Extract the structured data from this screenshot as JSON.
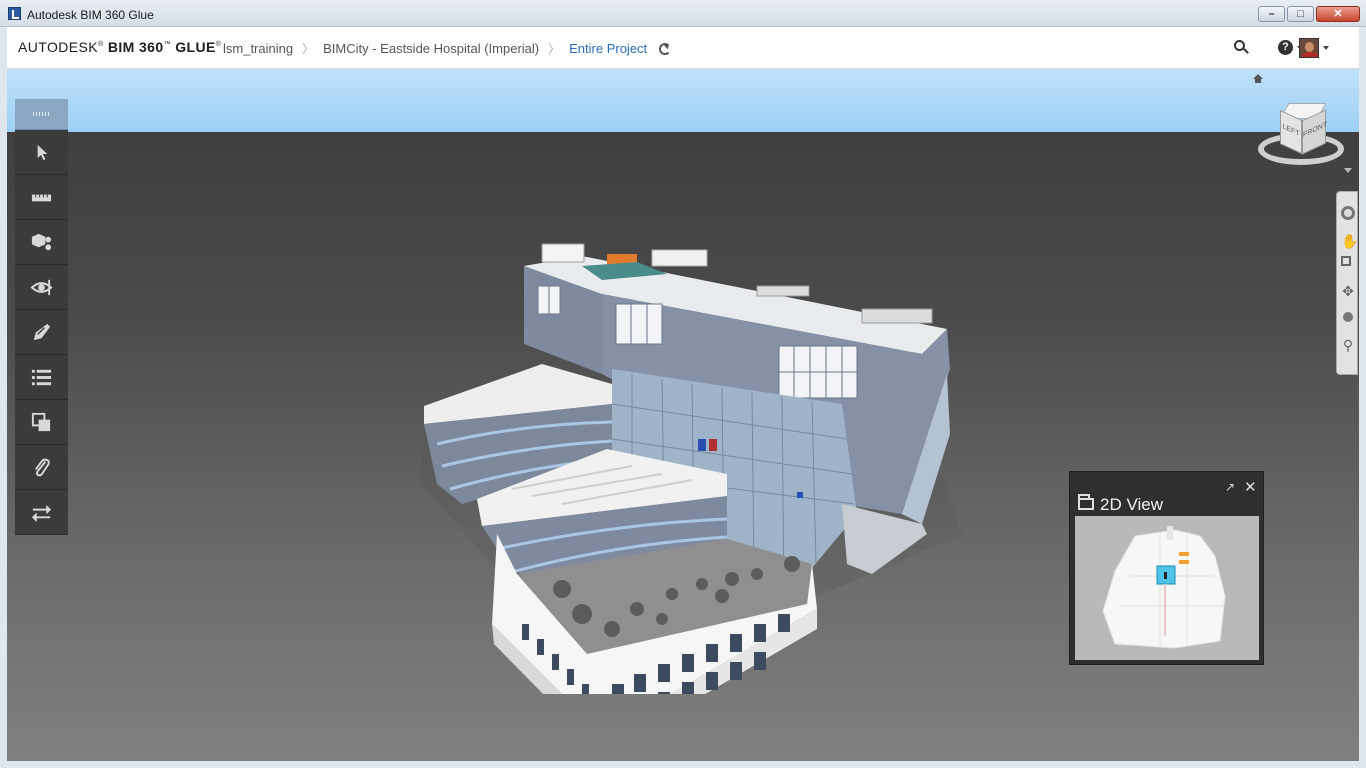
{
  "window": {
    "title": "Autodesk BIM 360 Glue",
    "buttons": {
      "minimize": "–",
      "maximize": "□",
      "close": "✕"
    }
  },
  "header": {
    "logo_prefix": "AUTODESK",
    "logo_product": "BIM 360",
    "logo_suffix": "GLUE",
    "breadcrumbs": [
      "lsm_training",
      "BIMCity - Eastside Hospital (Imperial)",
      "Entire Project"
    ],
    "breadcrumb_sep": "〉",
    "help_label": "?"
  },
  "navcube": {
    "left_label": "LEFT",
    "front_label": "FRONT"
  },
  "toolbar": {
    "items": [
      {
        "name": "select-icon"
      },
      {
        "name": "measure-icon"
      },
      {
        "name": "model-browser-icon"
      },
      {
        "name": "views-icon"
      },
      {
        "name": "markup-icon"
      },
      {
        "name": "list-icon"
      },
      {
        "name": "clash-icon"
      },
      {
        "name": "attachment-icon"
      },
      {
        "name": "transfer-icon"
      }
    ]
  },
  "two_d_view": {
    "title": "2D View",
    "popout": "↗",
    "close": "✕"
  },
  "colors": {
    "accent": "#2a6eb8",
    "sky": "#9dd0f5",
    "toolbar": "#3b3b3b",
    "grip": "#8aa6c0"
  }
}
